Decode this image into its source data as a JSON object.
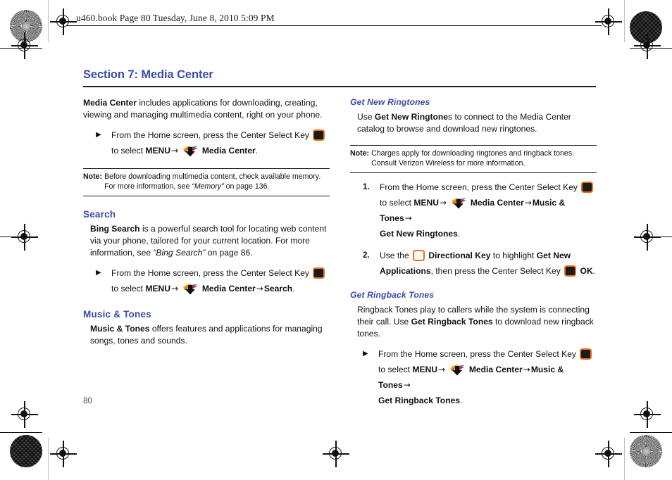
{
  "page": {
    "running_header": "u460.book  Page 80  Tuesday, June 8, 2010  5:09 PM",
    "page_number": "80",
    "section_title": "Section 7: Media Center",
    "accent_color": "#3b4ba8",
    "key_border_color": "#e8701a",
    "arrow_glyph": "→",
    "bullet_glyph": "▶"
  },
  "icons": {
    "center_select_key": "center-select-key-icon",
    "directional_key": "directional-key-icon",
    "media_center": "media-center-icon"
  },
  "left_column": {
    "intro": {
      "lead_bold": "Media Center",
      "lead_rest": " includes applications for downloading, creating, viewing and managing multimedia content, right on your phone."
    },
    "intro_step": {
      "text_a": "From the Home screen, press the Center Select Key",
      "text_b": "to select ",
      "menu": "MENU",
      "target": "Media Center",
      "period": "."
    },
    "note": {
      "label": "Note:",
      "text_a": "Before downloading multimedia content, check available memory. For more information, see ",
      "text_italic": "“Memory”",
      "text_b": " on page 136."
    },
    "search": {
      "heading": "Search",
      "body_bold": "Bing Search",
      "body_a": " is a powerful search tool for locating web content via your phone, tailored for your current location. For more information, see ",
      "body_italic": "“Bing Search”",
      "body_b": " on page 86.",
      "step": {
        "text_a": "From the Home screen, press the Center Select Key",
        "text_b": "to select ",
        "menu": "MENU",
        "target1": "Media Center",
        "target2": "Search",
        "period": "."
      }
    },
    "music_tones": {
      "heading": "Music & Tones",
      "body_bold": "Music & Tones",
      "body_rest": " offers features and applications for managing songs, tones and sounds."
    }
  },
  "right_column": {
    "get_new_ringtones": {
      "heading": "Get New Ringtones",
      "body_a": "Use ",
      "body_bold": "Get New Ringtone",
      "body_b": "s to connect to the Media Center catalog to browse and download new ringtones."
    },
    "note": {
      "label": "Note:",
      "text": "Charges apply for downloading ringtones and ringback tones. Consult Verizon Wireless for more information."
    },
    "steps": [
      {
        "number": "1.",
        "text_a": "From the Home screen, press the Center Select Key",
        "text_b": "to select ",
        "menu": "MENU",
        "target1": "Media Center",
        "target2": "Music & Tones",
        "target3": "Get New Ringtones",
        "period": "."
      },
      {
        "number": "2.",
        "text_a": "Use the ",
        "key_label": "Directional Key",
        "text_b": " to highlight ",
        "highlight_target": "Get New Applications",
        "text_c": ", then press the Center Select Key",
        "ok_label": "OK",
        "period": "."
      }
    ],
    "get_ringback_tones": {
      "heading": "Get Ringback Tones",
      "body_a": "Ringback Tones play to callers while the system is connecting their call. Use ",
      "body_bold": "Get Ringback Tones",
      "body_b": " to download new ringback tones.",
      "step": {
        "text_a": "From the Home screen, press the Center Select Key",
        "text_b": "to select ",
        "menu": "MENU",
        "target1": "Media Center",
        "target2": "Music & Tones",
        "target3": "Get Ringback Tones",
        "period": "."
      }
    }
  }
}
